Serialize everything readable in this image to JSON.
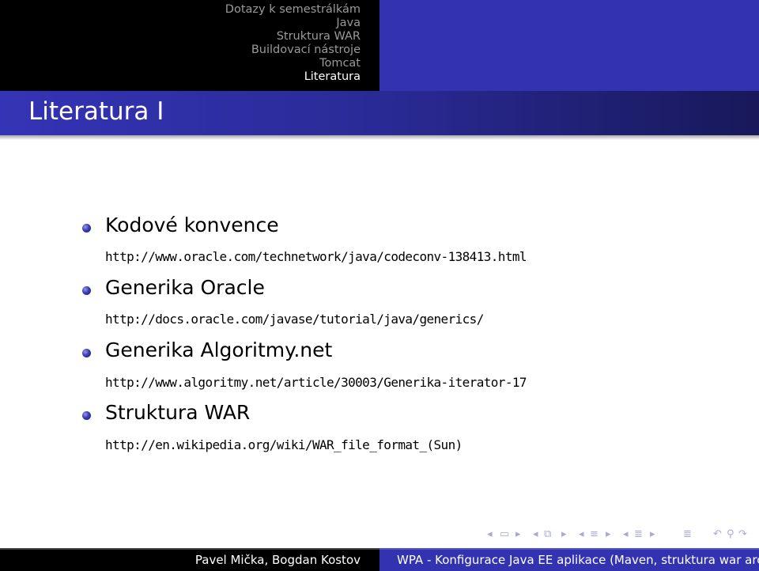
{
  "header": {
    "sections": [
      {
        "label": "Dotazy k semestrálkám",
        "active": false
      },
      {
        "label": "Java",
        "active": false
      },
      {
        "label": "Struktura WAR",
        "active": false
      },
      {
        "label": "Buildovací nástroje",
        "active": false
      },
      {
        "label": "Tomcat",
        "active": false
      },
      {
        "label": "Literatura",
        "active": true
      }
    ]
  },
  "frame": {
    "title": "Literatura I"
  },
  "items": [
    {
      "title": "Kodové konvence",
      "url": "http://www.oracle.com/technetwork/java/codeconv-138413.html"
    },
    {
      "title": "Generika Oracle",
      "url": "http://docs.oracle.com/javase/tutorial/java/generics/"
    },
    {
      "title": "Generika Algoritmy.net",
      "url": "http://www.algoritmy.net/article/30003/Generika-iterator-17"
    },
    {
      "title": "Struktura WAR",
      "url": "http://en.wikipedia.org/wiki/WAR_file_format_(Sun)"
    }
  ],
  "navigation": {
    "icons": [
      "nav-left",
      "slide-icon",
      "nav-right",
      "nav-left",
      "frame-icon",
      "nav-right",
      "nav-left",
      "subsection-icon",
      "nav-right",
      "nav-left",
      "section-icon",
      "nav-right",
      "align-icon",
      "undo-icon",
      "search-icon",
      "redo-icon"
    ]
  },
  "footer": {
    "author": "Pavel Mička, Bogdan Kostov",
    "title": "WPA - Konfigurace Java EE aplikace (Maven, struktura war archivu, Tomcat)"
  },
  "colors": {
    "accent": "#3333b2",
    "header_bg": "#000000",
    "nav_inactive": "#9a9a9a",
    "nav_active": "#ffffff"
  }
}
